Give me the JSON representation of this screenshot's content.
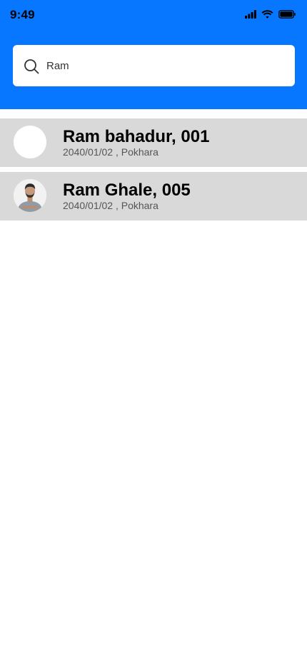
{
  "status_bar": {
    "time": "9:49",
    "icons": [
      "cellular-signal-icon",
      "wifi-icon",
      "battery-icon"
    ]
  },
  "colors": {
    "header_bg": "#0677FE",
    "row_bg": "#D9D9D9"
  },
  "search": {
    "value": "Ram",
    "icon": "search-icon"
  },
  "results": [
    {
      "name": "Ram bahadur, 001",
      "subtitle": "2040/01/02 , Pokhara",
      "avatar": "blank"
    },
    {
      "name": "Ram Ghale, 005",
      "subtitle": "2040/01/02 , Pokhara",
      "avatar": "photo"
    }
  ]
}
